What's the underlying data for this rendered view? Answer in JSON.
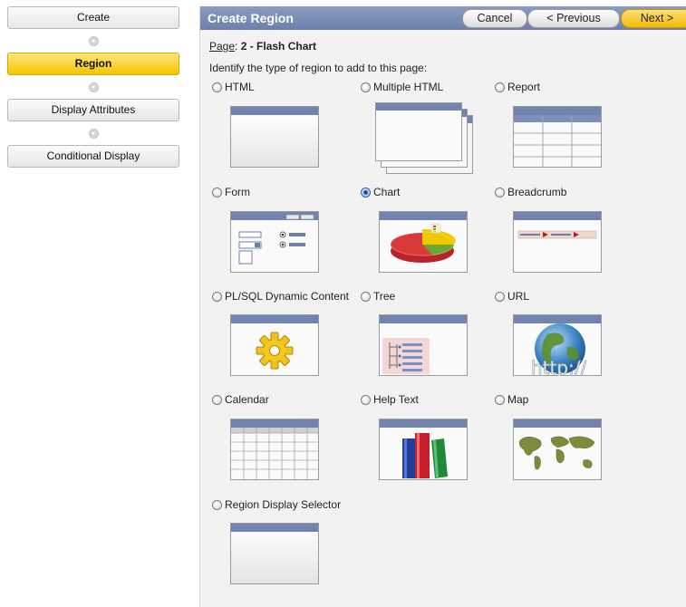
{
  "wizard": {
    "steps": [
      "Create",
      "Region",
      "Display Attributes",
      "Conditional Display"
    ],
    "active_step": "Region"
  },
  "panel": {
    "title": "Create Region",
    "buttons": {
      "cancel": "Cancel",
      "previous": "< Previous",
      "next": "Next >"
    },
    "page_label": "Page",
    "page_value": "2 - Flash Chart",
    "prompt": "Identify the type of region to add to this page:"
  },
  "region_types": [
    {
      "label": "HTML",
      "selected": false,
      "icon": "html-region-icon"
    },
    {
      "label": "Multiple HTML",
      "selected": false,
      "icon": "multiple-html-region-icon"
    },
    {
      "label": "Report",
      "selected": false,
      "icon": "report-region-icon"
    },
    {
      "label": "Form",
      "selected": false,
      "icon": "form-region-icon"
    },
    {
      "label": "Chart",
      "selected": true,
      "icon": "chart-region-icon"
    },
    {
      "label": "Breadcrumb",
      "selected": false,
      "icon": "breadcrumb-region-icon"
    },
    {
      "label": "PL/SQL Dynamic Content",
      "selected": false,
      "icon": "plsql-region-icon"
    },
    {
      "label": "Tree",
      "selected": false,
      "icon": "tree-region-icon"
    },
    {
      "label": "URL",
      "selected": false,
      "icon": "url-region-icon"
    },
    {
      "label": "Calendar",
      "selected": false,
      "icon": "calendar-region-icon"
    },
    {
      "label": "Help Text",
      "selected": false,
      "icon": "help-text-region-icon"
    },
    {
      "label": "Map",
      "selected": false,
      "icon": "map-region-icon"
    },
    {
      "label": "Region Display Selector",
      "selected": false,
      "icon": "region-display-selector-icon"
    }
  ],
  "thumb_text": {
    "url": "http://"
  },
  "colors": {
    "accent": "#f5c400",
    "titlebar": "#7a8cb4",
    "selected_radio": "#1f4f9a"
  }
}
